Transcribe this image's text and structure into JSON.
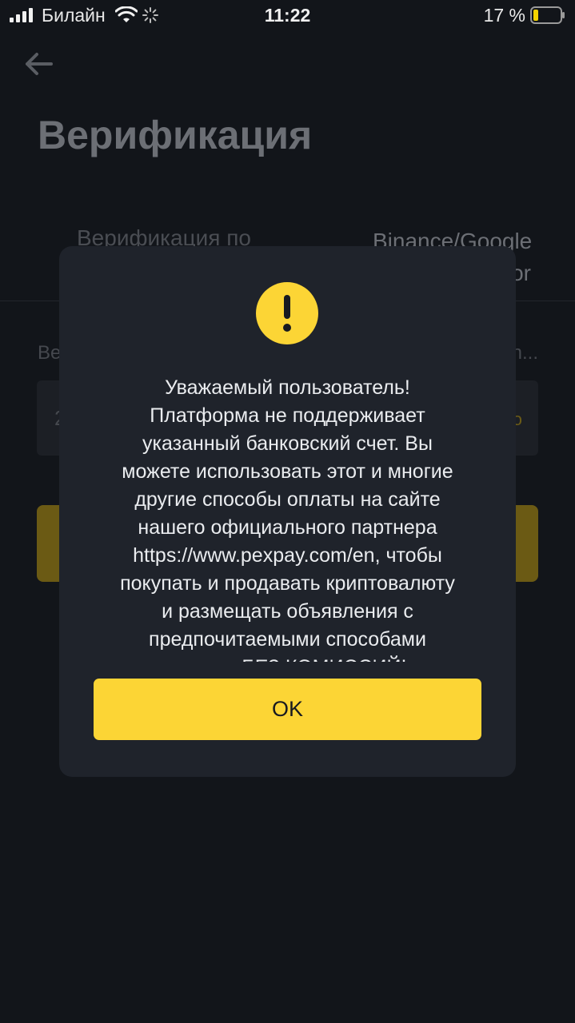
{
  "status_bar": {
    "carrier": "Билайн",
    "time": "11:22",
    "battery": "17 %",
    "icons": [
      "signal-icon",
      "wifi-icon",
      "loading-spinner-icon",
      "battery-icon"
    ]
  },
  "page": {
    "title": "Верификация",
    "tab_left": "Верификация по",
    "tab_right_line1": "Binance/Google",
    "tab_right_line2": "or",
    "field_label": "Ве",
    "field_label_right": "n...",
    "input_value": "2",
    "input_link": "о",
    "back_icon": "arrow-left-icon"
  },
  "dialog": {
    "icon": "warning-icon",
    "message": "Уважаемый пользователь!\nПлатформа не поддерживает\nуказанный банковский счет. Вы\nможете использовать этот и многие\nдругие способы оплаты на сайте\nнашего официального партнера\nhttps://www.pexpay.com/en, чтобы\nпокупать и продавать криптовалюту\nи размещать объявления с\nпредпочитаемыми способами\nоплаты БЕЗ КОМИССИЙ!",
    "ok_label": "OK"
  },
  "colors": {
    "accent": "#fcd535",
    "background": "#12151a",
    "dialog": "#1f232b"
  }
}
